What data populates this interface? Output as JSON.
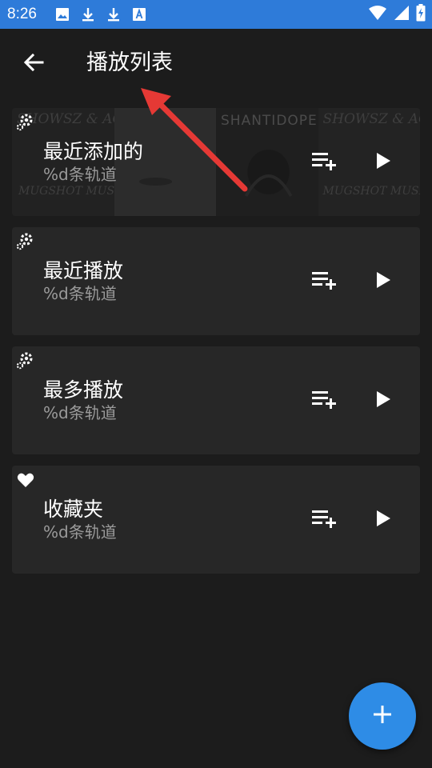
{
  "status_bar": {
    "time": "8:26",
    "left_icons": [
      "image-icon",
      "download-icon",
      "download-icon",
      "text-icon"
    ],
    "right_icons": [
      "wifi-icon",
      "signal-icon",
      "battery-icon"
    ],
    "background": "#2e7bd9"
  },
  "header": {
    "title": "播放列表",
    "back_icon": "arrow-left-icon"
  },
  "playlists": [
    {
      "title": "最近添加的",
      "subtitle": "%d条轨道",
      "type_icon": "gear-icon",
      "has_cover": true,
      "cover_texts": [
        "SHOWSZ & AG",
        "MUGSHOT MUSIC",
        "SHANTIDOPE",
        "SHOWSZ & AG",
        "MUGSHOT MUSIC"
      ]
    },
    {
      "title": "最近播放",
      "subtitle": "%d条轨道",
      "type_icon": "gear-icon",
      "has_cover": false
    },
    {
      "title": "最多播放",
      "subtitle": "%d条轨道",
      "type_icon": "gear-icon",
      "has_cover": false
    },
    {
      "title": "收藏夹",
      "subtitle": "%d条轨道",
      "type_icon": "heart-icon",
      "has_cover": false
    }
  ],
  "card_actions": {
    "add_icon": "playlist-add-icon",
    "play_icon": "play-icon"
  },
  "fab": {
    "icon": "plus-icon",
    "color": "#2e8ce6"
  },
  "annotation": {
    "color": "#e53935"
  },
  "colors": {
    "background": "#1c1c1c",
    "card": "#272727",
    "subtitle": "#9a9a9a"
  }
}
